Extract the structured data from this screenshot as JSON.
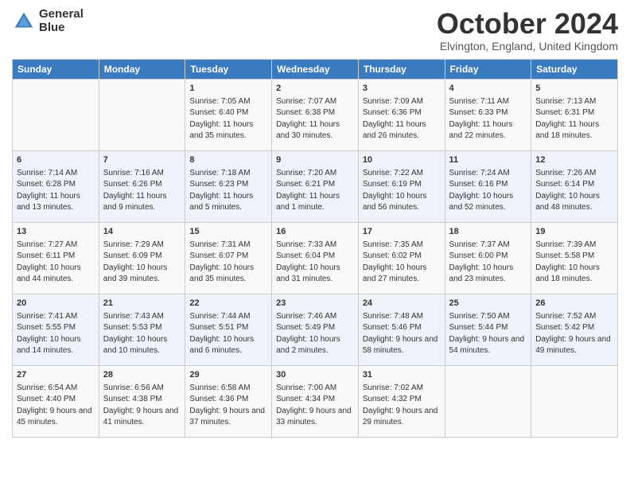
{
  "logo": {
    "line1": "General",
    "line2": "Blue"
  },
  "title": "October 2024",
  "location": "Elvington, England, United Kingdom",
  "days_of_week": [
    "Sunday",
    "Monday",
    "Tuesday",
    "Wednesday",
    "Thursday",
    "Friday",
    "Saturday"
  ],
  "weeks": [
    [
      {
        "day": "",
        "sunrise": "",
        "sunset": "",
        "daylight": ""
      },
      {
        "day": "",
        "sunrise": "",
        "sunset": "",
        "daylight": ""
      },
      {
        "day": "1",
        "sunrise": "Sunrise: 7:05 AM",
        "sunset": "Sunset: 6:40 PM",
        "daylight": "Daylight: 11 hours and 35 minutes."
      },
      {
        "day": "2",
        "sunrise": "Sunrise: 7:07 AM",
        "sunset": "Sunset: 6:38 PM",
        "daylight": "Daylight: 11 hours and 30 minutes."
      },
      {
        "day": "3",
        "sunrise": "Sunrise: 7:09 AM",
        "sunset": "Sunset: 6:36 PM",
        "daylight": "Daylight: 11 hours and 26 minutes."
      },
      {
        "day": "4",
        "sunrise": "Sunrise: 7:11 AM",
        "sunset": "Sunset: 6:33 PM",
        "daylight": "Daylight: 11 hours and 22 minutes."
      },
      {
        "day": "5",
        "sunrise": "Sunrise: 7:13 AM",
        "sunset": "Sunset: 6:31 PM",
        "daylight": "Daylight: 11 hours and 18 minutes."
      }
    ],
    [
      {
        "day": "6",
        "sunrise": "Sunrise: 7:14 AM",
        "sunset": "Sunset: 6:28 PM",
        "daylight": "Daylight: 11 hours and 13 minutes."
      },
      {
        "day": "7",
        "sunrise": "Sunrise: 7:16 AM",
        "sunset": "Sunset: 6:26 PM",
        "daylight": "Daylight: 11 hours and 9 minutes."
      },
      {
        "day": "8",
        "sunrise": "Sunrise: 7:18 AM",
        "sunset": "Sunset: 6:23 PM",
        "daylight": "Daylight: 11 hours and 5 minutes."
      },
      {
        "day": "9",
        "sunrise": "Sunrise: 7:20 AM",
        "sunset": "Sunset: 6:21 PM",
        "daylight": "Daylight: 11 hours and 1 minute."
      },
      {
        "day": "10",
        "sunrise": "Sunrise: 7:22 AM",
        "sunset": "Sunset: 6:19 PM",
        "daylight": "Daylight: 10 hours and 56 minutes."
      },
      {
        "day": "11",
        "sunrise": "Sunrise: 7:24 AM",
        "sunset": "Sunset: 6:16 PM",
        "daylight": "Daylight: 10 hours and 52 minutes."
      },
      {
        "day": "12",
        "sunrise": "Sunrise: 7:26 AM",
        "sunset": "Sunset: 6:14 PM",
        "daylight": "Daylight: 10 hours and 48 minutes."
      }
    ],
    [
      {
        "day": "13",
        "sunrise": "Sunrise: 7:27 AM",
        "sunset": "Sunset: 6:11 PM",
        "daylight": "Daylight: 10 hours and 44 minutes."
      },
      {
        "day": "14",
        "sunrise": "Sunrise: 7:29 AM",
        "sunset": "Sunset: 6:09 PM",
        "daylight": "Daylight: 10 hours and 39 minutes."
      },
      {
        "day": "15",
        "sunrise": "Sunrise: 7:31 AM",
        "sunset": "Sunset: 6:07 PM",
        "daylight": "Daylight: 10 hours and 35 minutes."
      },
      {
        "day": "16",
        "sunrise": "Sunrise: 7:33 AM",
        "sunset": "Sunset: 6:04 PM",
        "daylight": "Daylight: 10 hours and 31 minutes."
      },
      {
        "day": "17",
        "sunrise": "Sunrise: 7:35 AM",
        "sunset": "Sunset: 6:02 PM",
        "daylight": "Daylight: 10 hours and 27 minutes."
      },
      {
        "day": "18",
        "sunrise": "Sunrise: 7:37 AM",
        "sunset": "Sunset: 6:00 PM",
        "daylight": "Daylight: 10 hours and 23 minutes."
      },
      {
        "day": "19",
        "sunrise": "Sunrise: 7:39 AM",
        "sunset": "Sunset: 5:58 PM",
        "daylight": "Daylight: 10 hours and 18 minutes."
      }
    ],
    [
      {
        "day": "20",
        "sunrise": "Sunrise: 7:41 AM",
        "sunset": "Sunset: 5:55 PM",
        "daylight": "Daylight: 10 hours and 14 minutes."
      },
      {
        "day": "21",
        "sunrise": "Sunrise: 7:43 AM",
        "sunset": "Sunset: 5:53 PM",
        "daylight": "Daylight: 10 hours and 10 minutes."
      },
      {
        "day": "22",
        "sunrise": "Sunrise: 7:44 AM",
        "sunset": "Sunset: 5:51 PM",
        "daylight": "Daylight: 10 hours and 6 minutes."
      },
      {
        "day": "23",
        "sunrise": "Sunrise: 7:46 AM",
        "sunset": "Sunset: 5:49 PM",
        "daylight": "Daylight: 10 hours and 2 minutes."
      },
      {
        "day": "24",
        "sunrise": "Sunrise: 7:48 AM",
        "sunset": "Sunset: 5:46 PM",
        "daylight": "Daylight: 9 hours and 58 minutes."
      },
      {
        "day": "25",
        "sunrise": "Sunrise: 7:50 AM",
        "sunset": "Sunset: 5:44 PM",
        "daylight": "Daylight: 9 hours and 54 minutes."
      },
      {
        "day": "26",
        "sunrise": "Sunrise: 7:52 AM",
        "sunset": "Sunset: 5:42 PM",
        "daylight": "Daylight: 9 hours and 49 minutes."
      }
    ],
    [
      {
        "day": "27",
        "sunrise": "Sunrise: 6:54 AM",
        "sunset": "Sunset: 4:40 PM",
        "daylight": "Daylight: 9 hours and 45 minutes."
      },
      {
        "day": "28",
        "sunrise": "Sunrise: 6:56 AM",
        "sunset": "Sunset: 4:38 PM",
        "daylight": "Daylight: 9 hours and 41 minutes."
      },
      {
        "day": "29",
        "sunrise": "Sunrise: 6:58 AM",
        "sunset": "Sunset: 4:36 PM",
        "daylight": "Daylight: 9 hours and 37 minutes."
      },
      {
        "day": "30",
        "sunrise": "Sunrise: 7:00 AM",
        "sunset": "Sunset: 4:34 PM",
        "daylight": "Daylight: 9 hours and 33 minutes."
      },
      {
        "day": "31",
        "sunrise": "Sunrise: 7:02 AM",
        "sunset": "Sunset: 4:32 PM",
        "daylight": "Daylight: 9 hours and 29 minutes."
      },
      {
        "day": "",
        "sunrise": "",
        "sunset": "",
        "daylight": ""
      },
      {
        "day": "",
        "sunrise": "",
        "sunset": "",
        "daylight": ""
      }
    ]
  ]
}
